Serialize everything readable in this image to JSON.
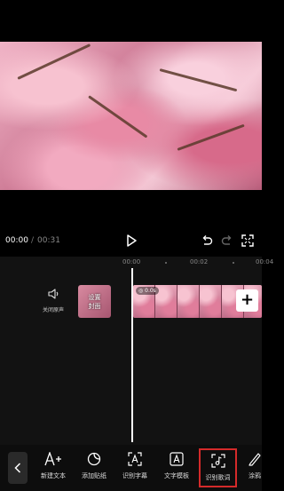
{
  "player": {
    "time_current": "00:00",
    "time_separator": "/",
    "time_total": "00:31"
  },
  "timeline": {
    "ticks": [
      "00:00",
      "00:02",
      "00:04"
    ],
    "mute_label": "关闭原声",
    "cover_label_line1": "设置",
    "cover_label_line2": "封面",
    "clip_badge": "◎ 0.0s",
    "add_symbol": "+"
  },
  "toolbar": {
    "items": [
      {
        "label": "新建文本",
        "icon": "text-plus-icon"
      },
      {
        "label": "添加贴纸",
        "icon": "sticker-icon"
      },
      {
        "label": "识别字幕",
        "icon": "recognize-subtitle-icon"
      },
      {
        "label": "文字模板",
        "icon": "text-template-icon"
      },
      {
        "label": "识别歌词",
        "icon": "recognize-lyrics-icon"
      },
      {
        "label": "涂鸦",
        "icon": "doodle-icon"
      }
    ]
  },
  "colors": {
    "highlight": "#d42a2a",
    "background": "#000000",
    "timeline_bg": "#121212"
  }
}
